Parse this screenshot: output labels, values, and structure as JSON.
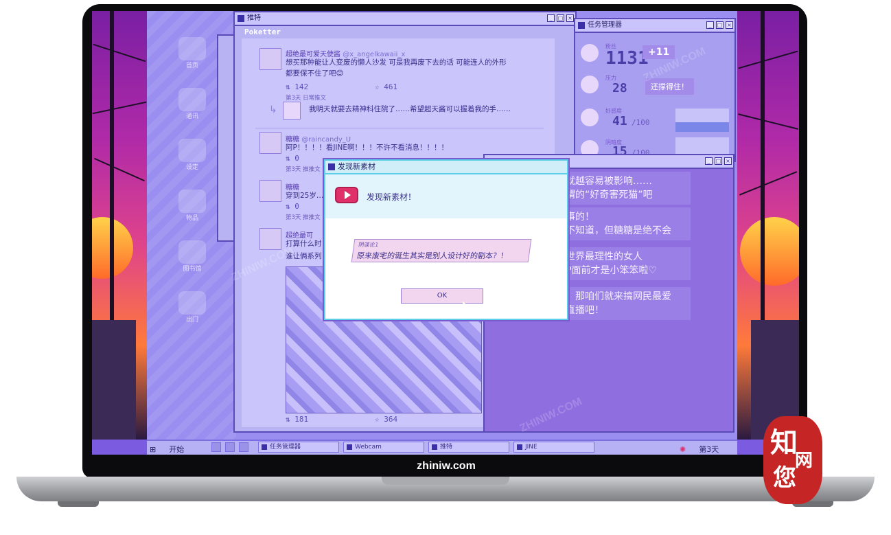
{
  "brand_caption": "zhiniw.com",
  "watermark_text": "ZHINIW.COM",
  "seal": {
    "chars": [
      "知",
      "网",
      "您"
    ]
  },
  "desktop": {
    "icons": [
      {
        "label": "首页",
        "icon": "home-icon"
      },
      {
        "label": "通讯",
        "icon": "chat-icon"
      },
      {
        "label": "设定",
        "icon": "gear-icon"
      },
      {
        "label": "物品",
        "icon": "box-icon"
      },
      {
        "label": "图书馆",
        "icon": "book-icon"
      },
      {
        "label": "出门",
        "icon": "door-icon"
      }
    ]
  },
  "poketter": {
    "title": "推特",
    "app_name": "Poketter",
    "posts": [
      {
        "name": "超绝最可爱天使酱",
        "handle": "@x_angelkawaii_x",
        "text1": "想买那种能让人变废的懒人沙发 可是我再废下去的话 可能连人的外形",
        "text2": "都要保不住了吧😊",
        "retweets": "142",
        "likes": "461",
        "meta": "第3天 日常推文"
      },
      {
        "reply": "我明天就要去精神科住院了……希望超天酱可以握着我的手……"
      },
      {
        "name": "糖糖",
        "handle": "@raincandy_U",
        "text1": "阿P！！！！看JINE啊！！！不许不看消息！！！！",
        "retweets": "0",
        "meta": "第3天 推推文"
      },
      {
        "name": "糖糖",
        "text1": "穿到25岁…",
        "retweets": "0",
        "meta": "第3天 推推文"
      },
      {
        "name": "超绝最可",
        "text1": "打算什么时",
        "text2": "谁让俩系列"
      }
    ],
    "bottom_stats": {
      "retweets": "181",
      "likes": "364"
    }
  },
  "task_manager": {
    "title": "任务管理器",
    "rows": [
      {
        "label": "粉丝",
        "value": "1131",
        "max": ""
      },
      {
        "label": "压力",
        "value": "28",
        "max": "/100"
      },
      {
        "label": "好感度",
        "value": "41",
        "max": "/100",
        "fill_pct": 0.41
      },
      {
        "label": "阴暗度",
        "value": "15",
        "max": "/100",
        "fill_pct": 0.15
      }
    ],
    "bubbles": [
      "+11",
      "还撑得住！"
    ]
  },
  "chat": {
    "messages": [
      "就越容易被影响……",
      "谓的“好奇害死猫”吧",
      "事的！",
      "不知道，但糖糖是绝不会",
      "世界最理性的女人",
      "P面前才是小笨笨啦♡",
      "，那咱们就来搞网民最爱",
      "直播吧！"
    ]
  },
  "dialog": {
    "title": "发现新素材",
    "heading": "发现新素材！",
    "card_tag": "阴谋论1",
    "card_text": "原来废宅的诞生其实是别人设计好的剧本？！",
    "ok_label": "OK"
  },
  "taskbar": {
    "start_label": "开始",
    "tasks": [
      "任务管理器",
      "Webcam",
      "推特",
      "JINE"
    ],
    "day_label": "第3天"
  },
  "colors": {
    "accent": "#5a4ab8",
    "dialog_border": "#5ad0e8",
    "play_icon": "#e0306a",
    "seal": "#c62525"
  }
}
